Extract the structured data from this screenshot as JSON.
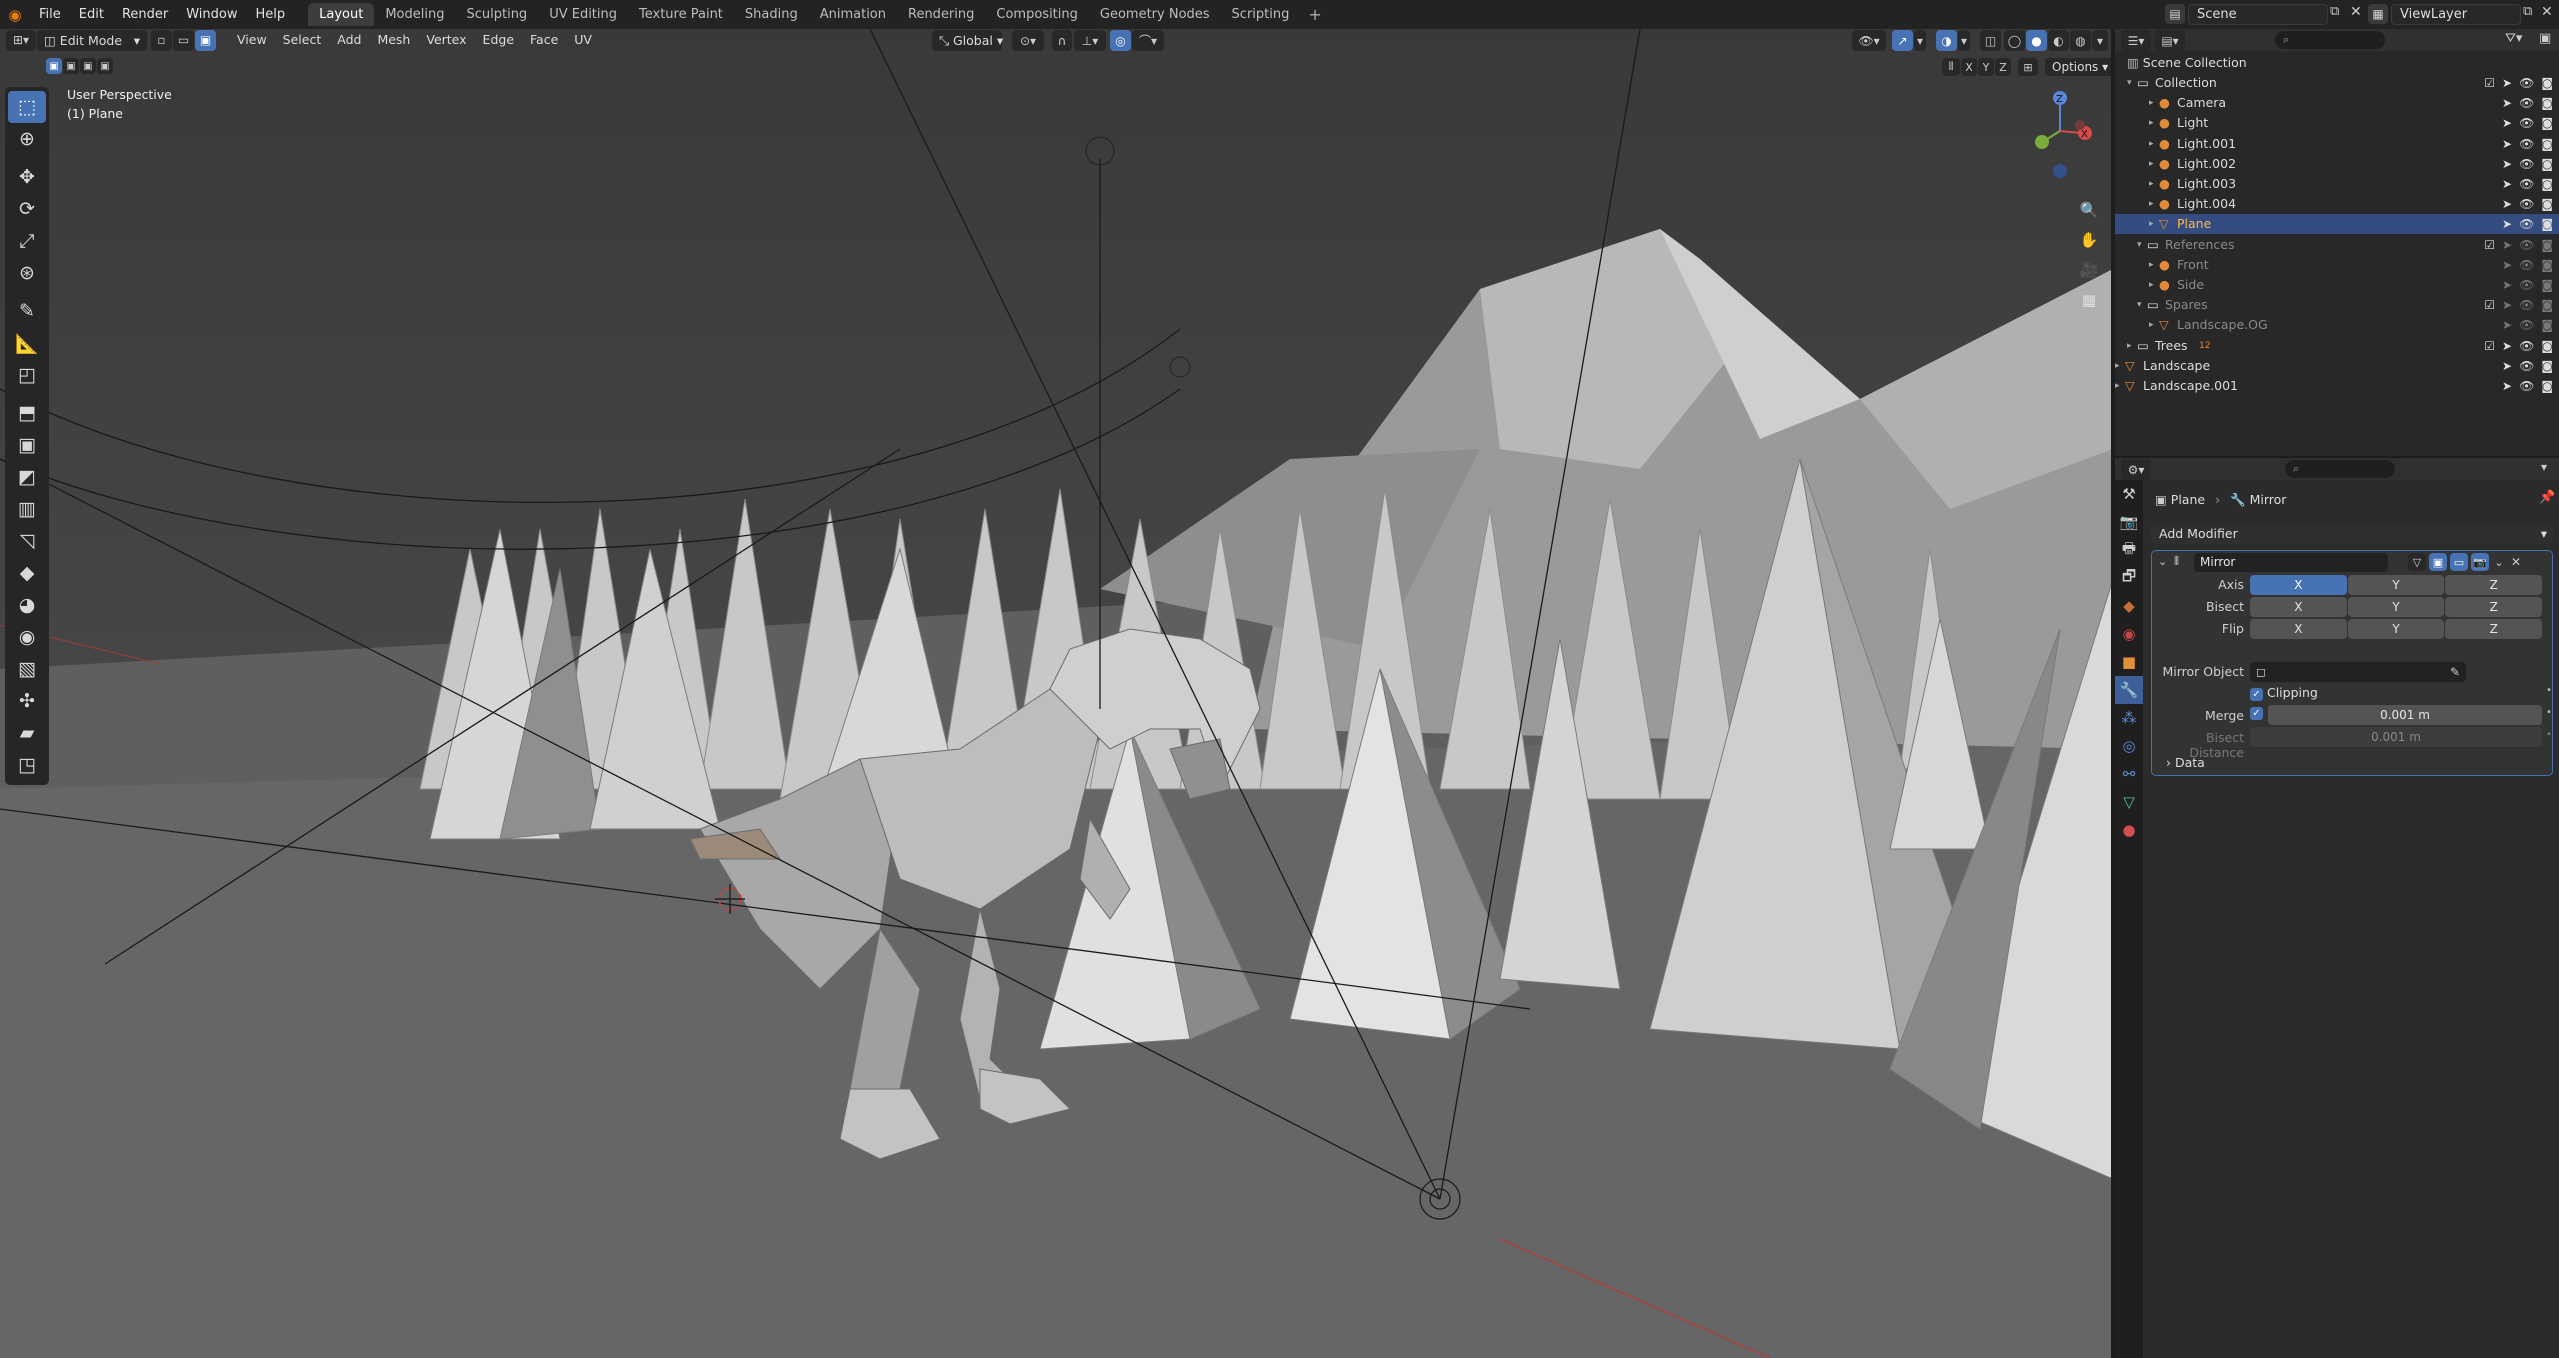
{
  "app": {
    "logo_icon": "blender-logo-icon"
  },
  "menus": [
    "File",
    "Edit",
    "Render",
    "Window",
    "Help"
  ],
  "workspaces": [
    "Layout",
    "Modeling",
    "Sculpting",
    "UV Editing",
    "Texture Paint",
    "Shading",
    "Animation",
    "Rendering",
    "Compositing",
    "Geometry Nodes",
    "Scripting"
  ],
  "active_workspace": "Layout",
  "add_workspace": "+",
  "scene": "Scene",
  "view_layer": "ViewLayer",
  "viewport": {
    "mode": "Edit Mode",
    "menus": [
      "View",
      "Select",
      "Add",
      "Mesh",
      "Vertex",
      "Edge",
      "Face",
      "UV"
    ],
    "transform_orientation": "Global",
    "options": "Options",
    "axes": [
      "X",
      "Y",
      "Z"
    ],
    "overlay_title": "User Perspective",
    "overlay_subtitle": "(1) Plane",
    "gizmo": {
      "z": "Z",
      "y": "Y",
      "x": "X"
    }
  },
  "outliner": {
    "root": "Scene Collection",
    "rows": [
      {
        "label": "Collection",
        "kind": "collection"
      },
      {
        "label": "Camera",
        "kind": "object"
      },
      {
        "label": "Light",
        "kind": "object"
      },
      {
        "label": "Light.001",
        "kind": "object"
      },
      {
        "label": "Light.002",
        "kind": "object"
      },
      {
        "label": "Light.003",
        "kind": "object"
      },
      {
        "label": "Light.004",
        "kind": "object"
      },
      {
        "label": "Plane",
        "kind": "object",
        "selected": true
      },
      {
        "label": "References",
        "kind": "collection",
        "dim": true
      },
      {
        "label": "Front",
        "kind": "object",
        "dim": true
      },
      {
        "label": "Side",
        "kind": "object",
        "dim": true
      },
      {
        "label": "Spares",
        "kind": "collection",
        "dim": true
      },
      {
        "label": "Landscape.OG",
        "kind": "object",
        "dim": true
      },
      {
        "label": "Trees",
        "kind": "collection",
        "badge": "12"
      },
      {
        "label": "Landscape",
        "kind": "object"
      },
      {
        "label": "Landscape.001",
        "kind": "object"
      }
    ]
  },
  "properties": {
    "breadcrumb_object": "Plane",
    "breadcrumb_modifier": "Mirror",
    "add_modifier": "Add Modifier",
    "modifier_name": "Mirror",
    "axis_label": "Axis",
    "bisect_label": "Bisect",
    "flip_label": "Flip",
    "xyz": [
      "X",
      "Y",
      "Z"
    ],
    "mirror_object_label": "Mirror Object",
    "clipping_label": "Clipping",
    "merge_label": "Merge",
    "merge_value": "0.001 m",
    "bisect_distance_label": "Bisect Distance",
    "bisect_distance_value": "0.001 m",
    "data_label": "Data"
  },
  "colors": {
    "accent": "#4772b3",
    "selected_row": "#334d80",
    "viewport_bg": "#3d3d3d"
  }
}
